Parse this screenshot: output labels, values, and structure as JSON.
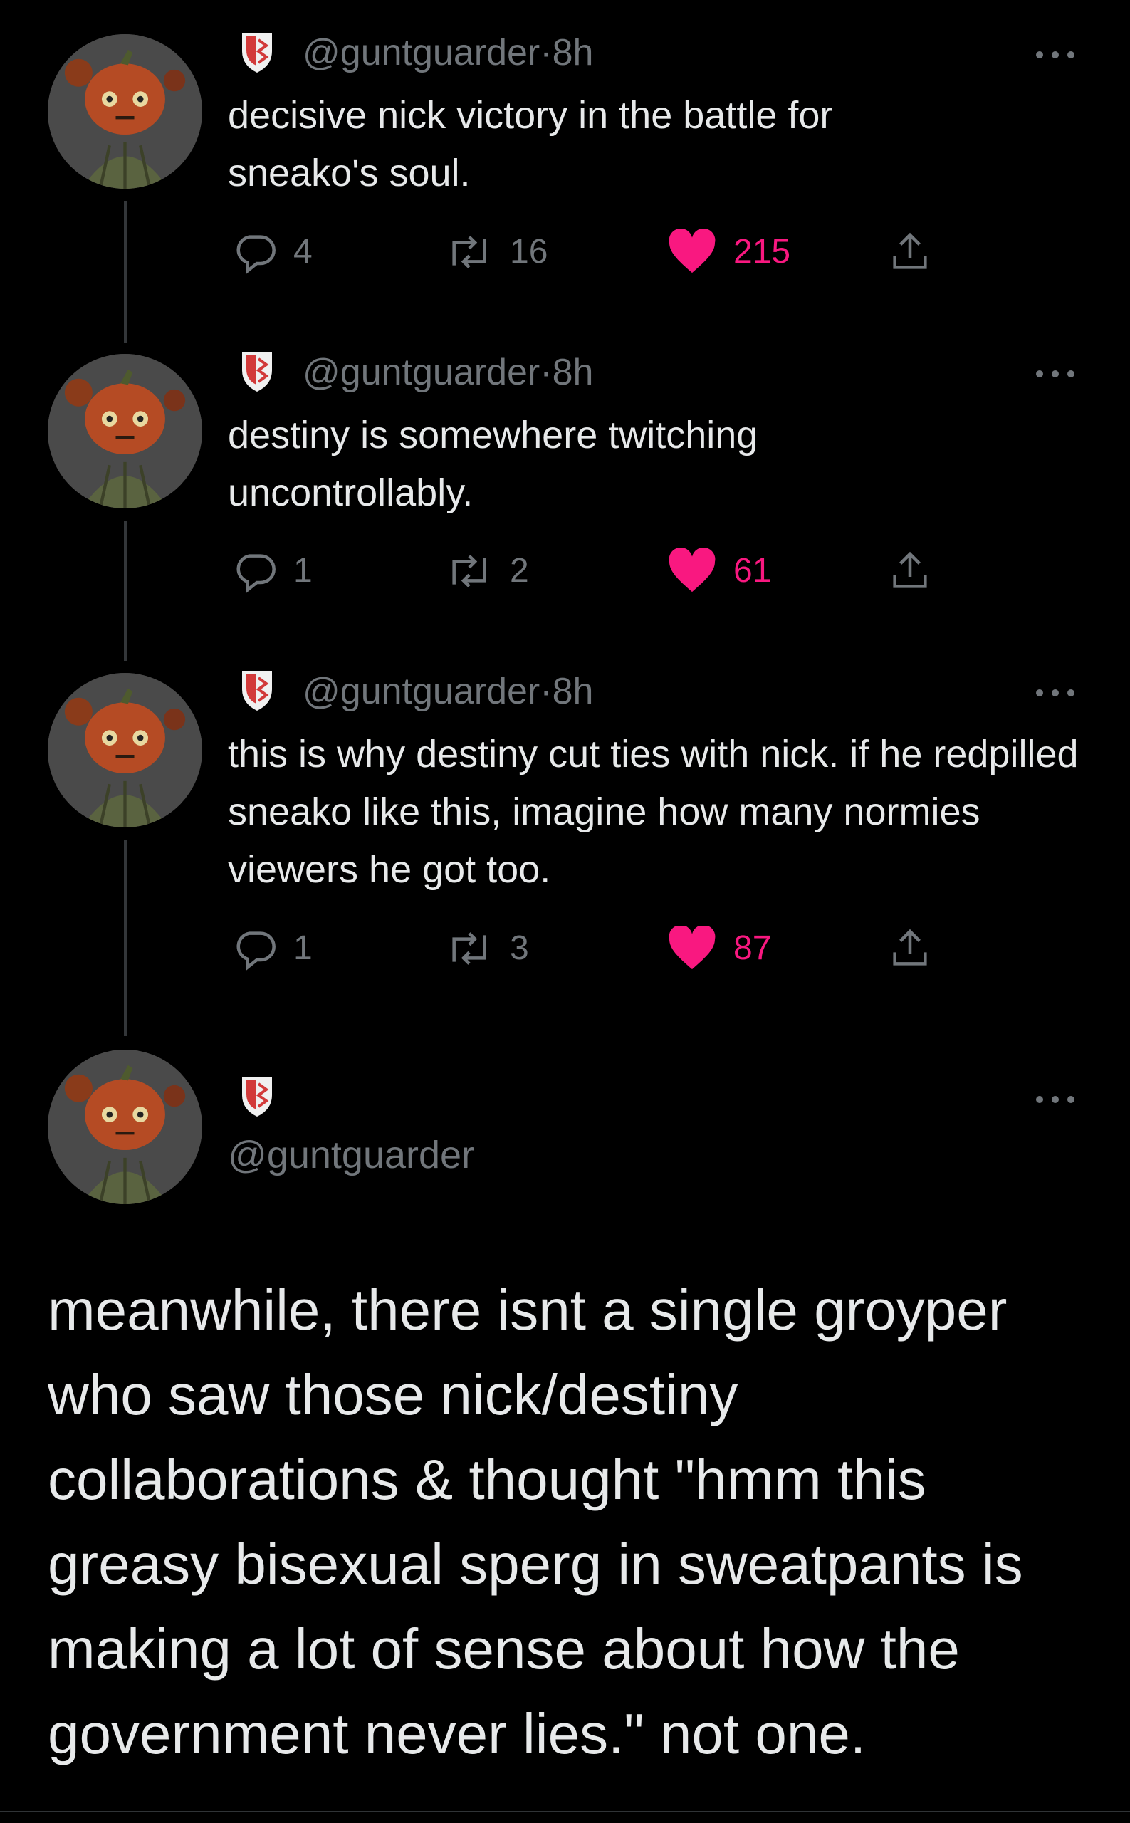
{
  "colors": {
    "background": "#000000",
    "text_primary": "#e7e9ea",
    "text_secondary": "#71767b",
    "like_pink": "#f91880",
    "thread_line": "#333639"
  },
  "tweets": [
    {
      "handle": "@guntguarder",
      "separator": "·",
      "time": "8h",
      "text": "decisive nick victory in the battle for sneako's soul.",
      "replies": "4",
      "retweets": "16",
      "likes": "215",
      "liked": true
    },
    {
      "handle": "@guntguarder",
      "separator": "·",
      "time": "8h",
      "text": "destiny is somewhere twitching uncontrollably.",
      "replies": "1",
      "retweets": "2",
      "likes": "61",
      "liked": true
    },
    {
      "handle": "@guntguarder",
      "separator": "·",
      "time": "8h",
      "text": "this is why destiny cut ties with nick. if he redpilled sneako like this, imagine how many normies viewers he got too.",
      "replies": "1",
      "retweets": "3",
      "likes": "87",
      "liked": true
    }
  ],
  "main_tweet": {
    "handle": "@guntguarder",
    "text": "meanwhile, there isnt a single groyper who saw those nick/destiny collaborations & thought \"hmm this greasy bisexual sperg in sweatpants is making a lot of sense about how the government never lies.\" not one."
  },
  "icons": {
    "avatar": "pumpkin-head-avatar",
    "badge": "shield-icon",
    "more": "more-options-icon",
    "reply": "reply-bubble-icon",
    "retweet": "retweet-icon",
    "like": "heart-icon",
    "share": "share-icon"
  }
}
